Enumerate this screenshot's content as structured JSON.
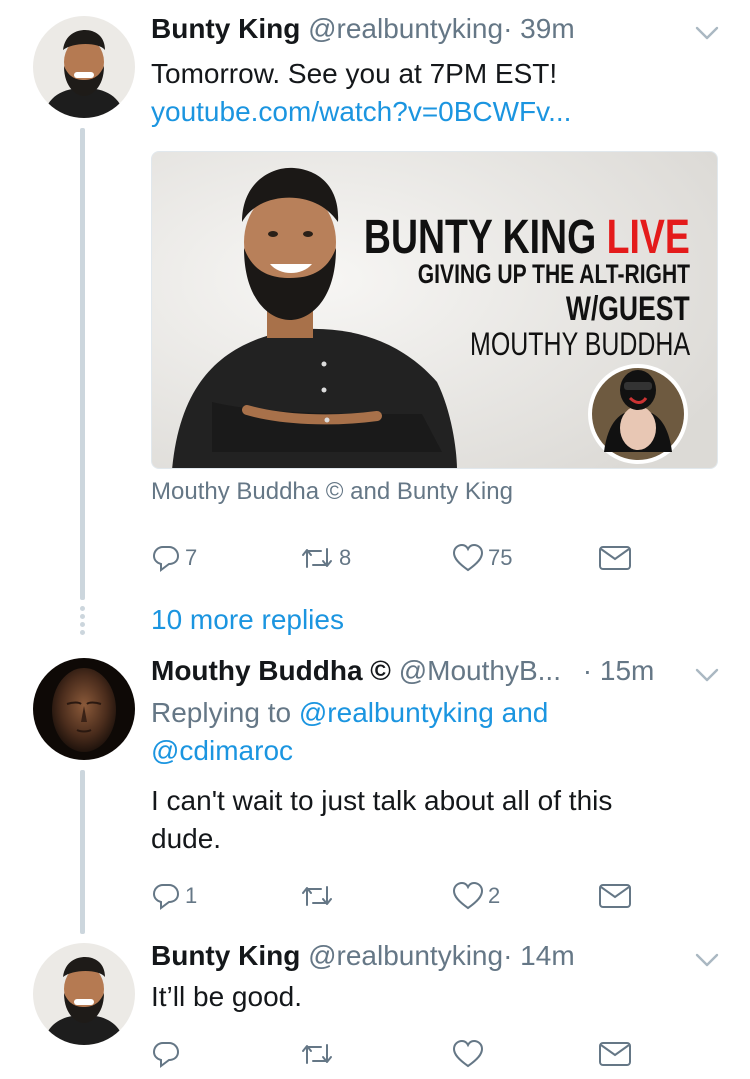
{
  "colors": {
    "link": "#1b95e0",
    "muted": "#657786",
    "text": "#14171a",
    "thread_line": "#ccd6dd",
    "live_red": "#e41b1b"
  },
  "tweets": [
    {
      "name": "Bunty King",
      "handle": "@realbuntyking",
      "time": "· 39m",
      "text": "Tomorrow. See you at 7PM EST!",
      "link": "youtube.com/watch?v=0BCWFv...",
      "card": {
        "title_main": "BUNTY KING",
        "title_live": "LIVE",
        "subtitle": "GIVING UP THE ALT-RIGHT",
        "guest_label": "W/GUEST",
        "guest_name": "MOUTHY BUDDHA"
      },
      "caption": "Mouthy Buddha © and Bunty King",
      "actions": {
        "replies": "7",
        "retweets": "8",
        "likes": "75"
      }
    },
    {
      "name": "Mouthy Buddha ©",
      "handle": "@MouthyB...",
      "time": "· 15m",
      "replying_prefix": "Replying to",
      "replying_user1": "@realbuntyking",
      "replying_and": "and",
      "replying_user2": "@cdimaroc",
      "text_line1": "I can't wait to just talk about all of this",
      "text_line2": "dude.",
      "actions": {
        "replies": "1",
        "retweets": "",
        "likes": "2"
      }
    },
    {
      "name": "Bunty King",
      "handle": "@realbuntyking",
      "time": "· 14m",
      "text": "It’ll be good.",
      "actions": {
        "replies": "",
        "retweets": "",
        "likes": ""
      }
    }
  ],
  "more_replies": "10 more replies",
  "icons": [
    "reply-icon",
    "retweet-icon",
    "like-icon",
    "direct-message-icon",
    "chevron-down-icon"
  ]
}
